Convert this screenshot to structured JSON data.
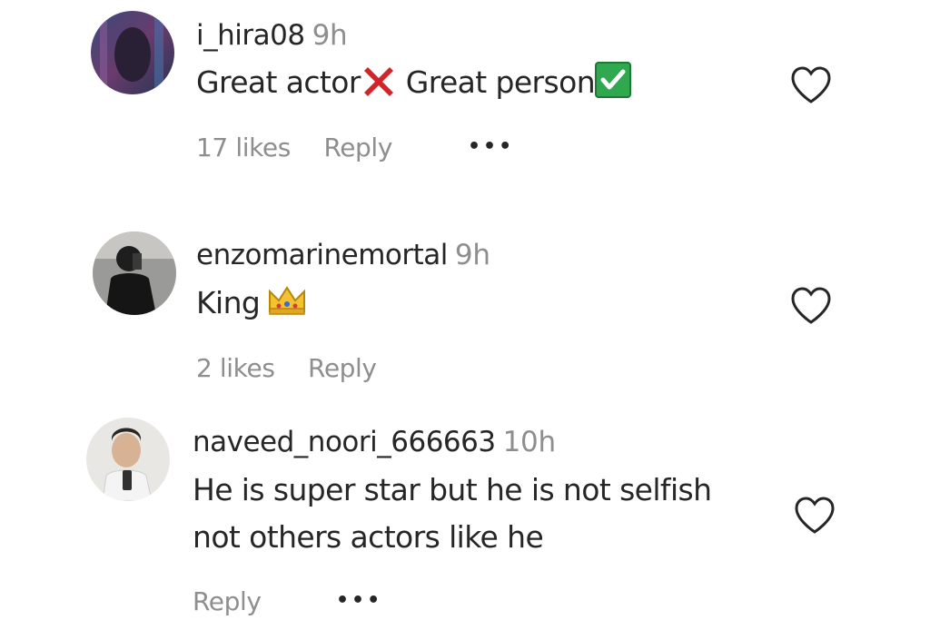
{
  "comments": [
    {
      "username": "i_hira08",
      "time": "9h",
      "text_part1": "Great actor",
      "text_part2": " Great person",
      "likes": "17 likes",
      "reply": "Reply",
      "more": "•••"
    },
    {
      "username": "enzomarinemortal",
      "time": "9h",
      "text": "King",
      "likes": "2 likes",
      "reply": "Reply"
    },
    {
      "username": "naveed_noori_666663",
      "time": "10h",
      "text_line1": "He is super star but he is not selfish",
      "text_line2": "not others actors like he",
      "reply": "Reply",
      "more": "•••"
    }
  ],
  "colors": {
    "text": "#262626",
    "muted": "#8e8e8e",
    "x_red": "#d0262b",
    "check_green": "#2fa84f"
  },
  "icons": {
    "like": "heart-outline-icon",
    "more": "more-dots-icon",
    "x": "cross-mark-emoji",
    "check": "check-mark-button-emoji",
    "crown": "crown-emoji"
  }
}
